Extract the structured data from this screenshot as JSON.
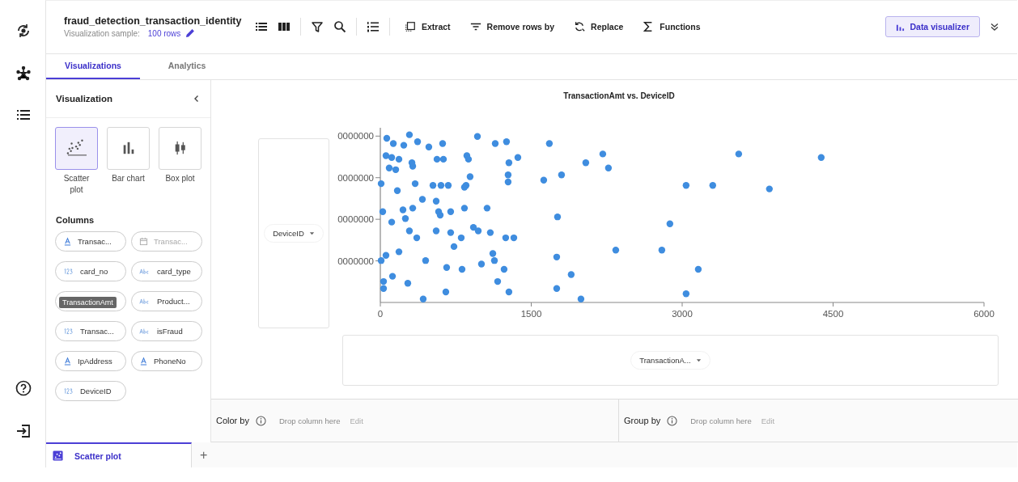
{
  "dataset": {
    "title": "fraud_detection_transaction_identity",
    "sample_label": "Visualization sample:",
    "sample_value": "100 rows"
  },
  "toolbar": {
    "actions": [
      {
        "label": "Extract",
        "kind": "extract"
      },
      {
        "label": "Remove rows by",
        "kind": "filter"
      },
      {
        "label": "Replace",
        "kind": "replace"
      },
      {
        "label": "Functions",
        "kind": "sigma"
      }
    ],
    "primary": "Data visualizer"
  },
  "tabs": [
    {
      "label": "Visualizations",
      "selected": true
    },
    {
      "label": "Analytics",
      "selected": false
    }
  ],
  "panel": {
    "title": "Visualization",
    "chart_types": [
      {
        "label": "Scatter plot",
        "kind": "scatter",
        "selected": true
      },
      {
        "label": "Bar chart",
        "kind": "bar",
        "selected": false
      },
      {
        "label": "Box plot",
        "kind": "box",
        "selected": false
      }
    ],
    "columns_title": "Columns",
    "columns": [
      {
        "label": "Transac...",
        "kind": "text",
        "disabled": false
      },
      {
        "label": "Transac...",
        "kind": "date",
        "disabled": true
      },
      {
        "label": "card_no",
        "kind": "number",
        "disabled": false
      },
      {
        "label": "card_type",
        "kind": "string",
        "disabled": false
      },
      {
        "tooltip": "TransactionAmt"
      },
      {
        "label": "Product...",
        "kind": "string",
        "disabled": false
      },
      {
        "label": "Transac...",
        "kind": "number",
        "disabled": false
      },
      {
        "label": "isFraud",
        "kind": "string",
        "disabled": false
      },
      {
        "label": "IpAddress",
        "kind": "text",
        "disabled": false
      },
      {
        "label": "PhoneNo",
        "kind": "text",
        "disabled": false
      },
      {
        "label": "DeviceID",
        "kind": "number",
        "disabled": false
      }
    ]
  },
  "chart": {
    "title": "TransactionAmt vs. DeviceID",
    "y_field": "DeviceID",
    "x_field": "TransactionA...",
    "y_tick_labels": [
      "0000000",
      "0000000",
      "0000000",
      "0000000"
    ],
    "x_tick_labels": [
      "0",
      "1500",
      "3000",
      "4500",
      "6000"
    ]
  },
  "encodings": [
    {
      "label": "Color by",
      "placeholder": "Drop column here",
      "action": "Edit"
    },
    {
      "label": "Group by",
      "placeholder": "Drop column here",
      "action": "Edit"
    }
  ],
  "sheets": [
    {
      "label": "Scatter plot",
      "selected": true
    }
  ],
  "add_sheet": "+"
}
